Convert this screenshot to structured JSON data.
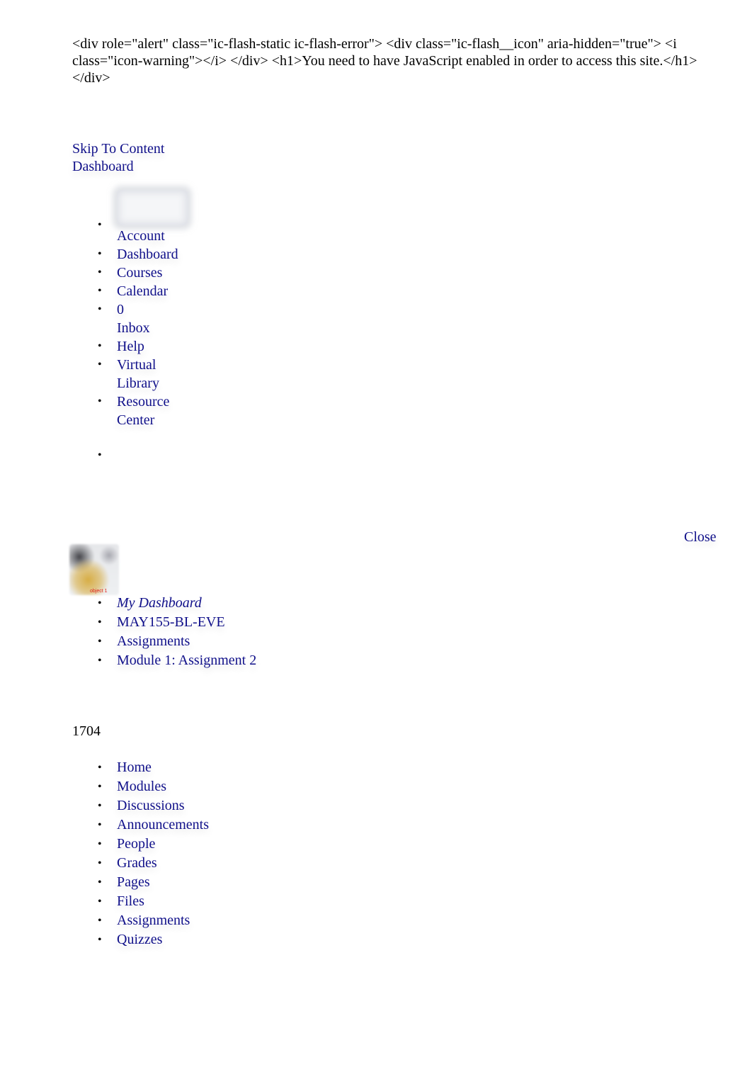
{
  "noscript_message": "<div role=\"alert\" class=\"ic-flash-static ic-flash-error\"> <div class=\"ic-flash__icon\" aria-hidden=\"true\"> <i class=\"icon-warning\"></i> </div> <h1>You need to have JavaScript enabled in order to access this site.</h1> </div>",
  "top_links": {
    "skip_to_content": "Skip To Content",
    "dashboard": "Dashboard"
  },
  "global_nav": {
    "items": [
      {
        "label": "Account",
        "icon": "avatar-icon"
      },
      {
        "label": "Dashboard"
      },
      {
        "label": "Courses"
      },
      {
        "label": "Calendar"
      },
      {
        "badge": "0",
        "label": "Inbox"
      },
      {
        "label": "Help"
      },
      {
        "label_line1": "Virtual",
        "label_line2": "Library"
      },
      {
        "label_line1": "Resource",
        "label_line2": "Center"
      },
      {
        "label": ""
      }
    ]
  },
  "close_label": "Close",
  "course_logo": {
    "caption": "object 1"
  },
  "breadcrumbs": [
    "My Dashboard",
    "MAY155-BL-EVE",
    "Assignments",
    "Module 1: Assignment 2"
  ],
  "course_number": "1704",
  "course_nav": [
    "Home",
    "Modules",
    "Discussions",
    "Announcements",
    "People",
    "Grades",
    "Pages",
    "Files",
    "Assignments",
    "Quizzes"
  ],
  "colors": {
    "link": "#10108a",
    "text": "#000000",
    "logo_caption": "#e0201c"
  }
}
